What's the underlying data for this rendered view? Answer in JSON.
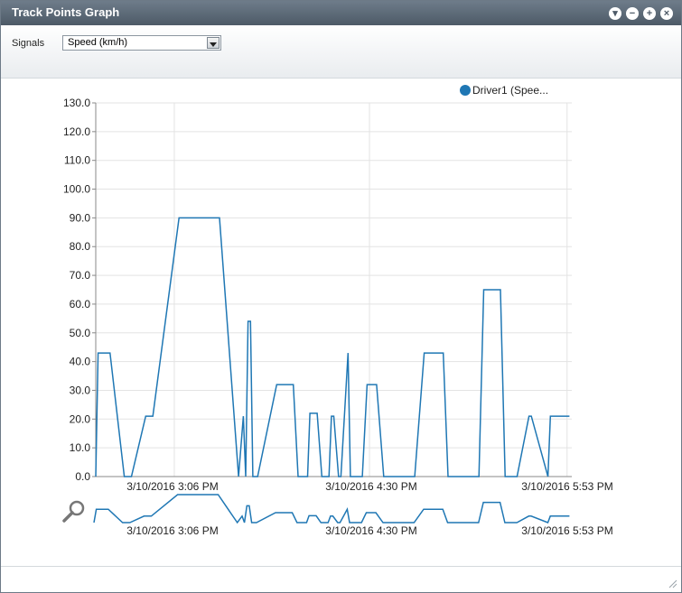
{
  "window": {
    "title": "Track Points Graph",
    "buttons": [
      "minimize-icon",
      "collapse-icon",
      "maximize-icon",
      "close-icon"
    ]
  },
  "toolbar": {
    "signals_label": "Signals",
    "signal_selected": "Speed (km/h)"
  },
  "legend": {
    "label": "Driver1 (Spee...",
    "color": "#1f77b4"
  },
  "chart_data": {
    "type": "line",
    "ylim": [
      0,
      130
    ],
    "yticks": [
      "0.0",
      "10.0",
      "20.0",
      "30.0",
      "40.0",
      "50.0",
      "60.0",
      "70.0",
      "80.0",
      "90.0",
      "100.0",
      "110.0",
      "120.0",
      "130.0"
    ],
    "xtick_labels": [
      "3/10/2016 3:06 PM",
      "3/10/2016 4:30 PM",
      "3/10/2016 5:53 PM"
    ],
    "xlim_minutes_note": "",
    "series": [
      {
        "name": "Driver1 (Spee...",
        "x": [
          0,
          0.5,
          3,
          6,
          7.5,
          10.5,
          12,
          17.5,
          26,
          30,
          31,
          31.5,
          32,
          32.5,
          33,
          33.5,
          34,
          38,
          41.5,
          42.5,
          44.5,
          45,
          46.5,
          47.5,
          49,
          49.5,
          50,
          51,
          51.5,
          53,
          53.5,
          56,
          57,
          59,
          60.5,
          67,
          69,
          73,
          74,
          80.5,
          81.5,
          85,
          86,
          88,
          88.5,
          91,
          91.5,
          95,
          95.5,
          99.5
        ],
        "values": [
          0,
          43,
          43,
          0,
          0,
          21,
          21,
          90,
          90,
          0,
          21,
          0,
          54,
          54,
          0,
          0,
          0,
          32,
          32,
          0,
          0,
          22,
          22,
          0,
          0,
          21,
          21,
          0,
          0,
          43,
          0,
          0,
          32,
          32,
          0,
          0,
          43,
          43,
          0,
          0,
          65,
          65,
          0,
          0,
          0,
          21,
          21,
          0,
          21,
          21
        ]
      }
    ]
  }
}
